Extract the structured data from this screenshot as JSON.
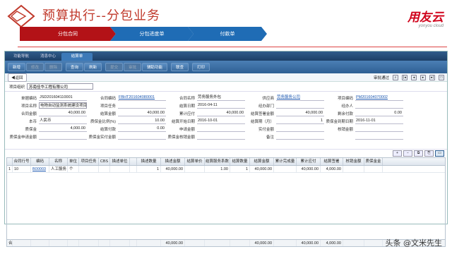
{
  "slide": {
    "title": "预算执行--分包业务"
  },
  "brand": {
    "main": "用友云",
    "sub": "yonyou cloud"
  },
  "flow": [
    "分包合同",
    "分包进度单",
    "付款单"
  ],
  "nav": {
    "tabs": [
      "功能导航",
      "消息中心",
      "结算单"
    ]
  },
  "toolbar": {
    "groups": [
      [
        "新增",
        "修改",
        "删除"
      ],
      [
        "查询",
        "刷新"
      ],
      [
        "提交",
        "审批",
        "辅助功能"
      ],
      [
        "联查"
      ],
      [
        "打印"
      ]
    ],
    "disabled": [
      "修改",
      "删除",
      "提交",
      "审批"
    ]
  },
  "subbar": {
    "back": "返回",
    "status": "审批通过"
  },
  "org": {
    "label": "项目组织",
    "value": "苏南佳华工程有限公司"
  },
  "form": {
    "rows": [
      [
        [
          "单据编码",
          "JSD201604110001",
          ""
        ],
        [
          "合同编码",
          "FBHT201604080001",
          "link"
        ],
        [
          "合同名称",
          "劳务服务外包",
          ""
        ],
        [
          "供应商",
          "劳务服务公司",
          "link"
        ],
        [
          "项目编码",
          "PM201604070002",
          "link"
        ]
      ],
      [
        [
          "项目名称",
          "电物自动监测系统建设项目",
          "boxed"
        ],
        [
          "项目任务",
          "",
          ""
        ],
        [
          "结算日期",
          "2016-04-11",
          ""
        ],
        [
          "经办部门",
          "",
          ""
        ],
        [
          "经办人",
          "",
          ""
        ]
      ],
      [
        [
          "合同金额",
          "40,000.00",
          "num"
        ],
        [
          "结算金额",
          "40,000.00",
          "num"
        ],
        [
          "累计应付",
          "40,000.00",
          "num"
        ],
        [
          "结算签署金额",
          "40,000.00",
          "num"
        ],
        [
          "剩余付款",
          "0.00",
          "num"
        ]
      ],
      [
        [
          "本币",
          "人民币",
          ""
        ],
        [
          "质保金比例(%)",
          "10.00",
          "num"
        ],
        [
          "结算开始日期",
          "2016-10-01",
          ""
        ],
        [
          "结算期（月）",
          "1",
          "num"
        ],
        [
          "质保金到期日期",
          "2016-11-01",
          ""
        ]
      ],
      [
        [
          "质保金",
          "4,000.00",
          "num"
        ],
        [
          "结算付款",
          "0.00",
          "num"
        ],
        [
          "申请金额",
          "",
          ""
        ],
        [
          "实付金额",
          "",
          ""
        ],
        [
          "核销金额",
          "",
          ""
        ]
      ],
      [
        [
          "质保金申请金额",
          "",
          ""
        ],
        [
          "质保金实付金额",
          "",
          ""
        ],
        [
          "质保金核销金额",
          "",
          ""
        ],
        [
          "备注",
          "",
          ""
        ],
        [
          "",
          "",
          ""
        ]
      ]
    ]
  },
  "grid": {
    "headers": [
      "",
      "合同行号",
      "编码",
      "名称",
      "单位",
      "项目任务",
      "CBS",
      "描述单位",
      "",
      "描述数量",
      "描述金额",
      "结算单价",
      "结算服务系数",
      "结算数量",
      "结算金额",
      "累计完成量",
      "累计应付",
      "结算签署",
      "核销金额",
      "质保金金"
    ],
    "rows": [
      [
        "1",
        "10",
        "B00003",
        "人工服务",
        "个",
        "",
        "",
        "",
        "",
        "1",
        "40,000.00",
        "",
        "1.00",
        "1",
        "40,000.00",
        "",
        "40,000.00",
        "4,000.00",
        "",
        ""
      ]
    ],
    "total": [
      "合计",
      "",
      "",
      "",
      "",
      "",
      "",
      "",
      "",
      "",
      "40,000.00",
      "",
      "",
      "",
      "40,000.00",
      "",
      "40,000.00",
      "4,000.00",
      "",
      ""
    ]
  },
  "watermark": "头条 @文米先生"
}
